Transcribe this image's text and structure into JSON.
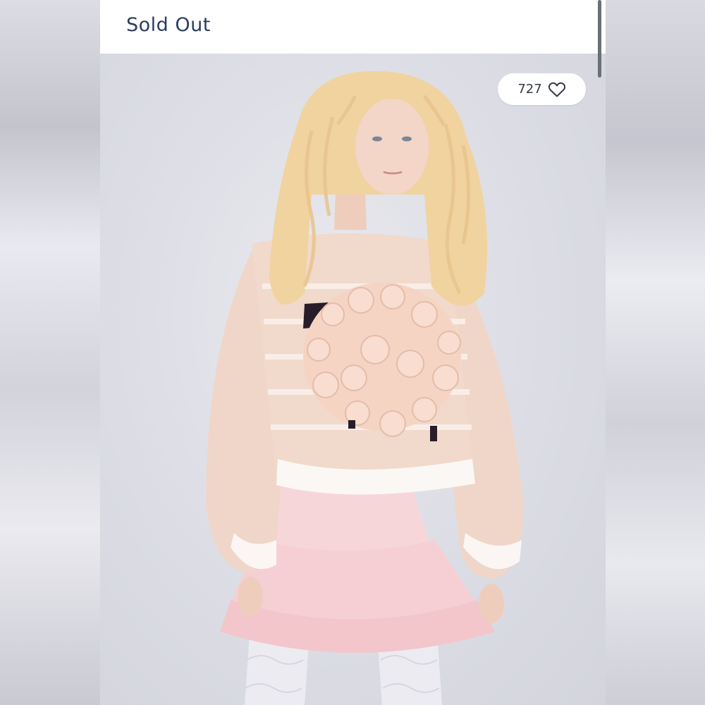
{
  "header": {
    "status_label": "Sold Out"
  },
  "product_image": {
    "like_count": "727",
    "like_icon": "heart-outline-icon"
  },
  "colors": {
    "status_text": "#2b3d5f",
    "sweater": "#f1d9cb",
    "skirt": "#f6cfd4",
    "hair": "#f1d3a0"
  }
}
